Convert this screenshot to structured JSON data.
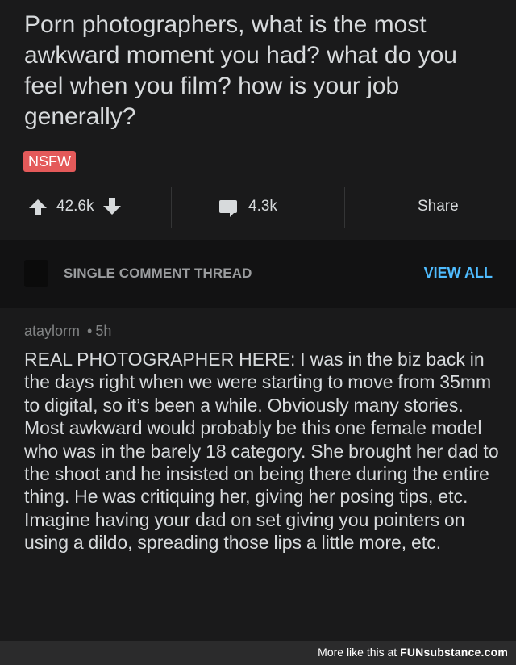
{
  "post": {
    "title": "Porn photographers, what is the most awkward moment you had? what do you feel when you film? how is your job generally?",
    "badge": "NSFW",
    "badge_color": "#e45a5a",
    "votes": "42.6k",
    "comments": "4.3k",
    "share_label": "Share"
  },
  "thread_bar": {
    "label": "SINGLE COMMENT THREAD",
    "view_all_label": "VIEW ALL",
    "view_all_color": "#4fbcff"
  },
  "comment": {
    "author": "ataylorm",
    "separator": "•",
    "age": "5h",
    "body": "REAL PHOTOGRAPHER HERE: I was in the biz back in the days right when we were starting to move from 35mm to digital, so it’s been a while. Obviously many stories. Most awkward would probably be this one female model who was in the barely 18 category. She brought her dad to the shoot and he insisted on being there during the entire thing. He was critiquing her, giving her posing tips, etc. Imagine having your dad on set giving you pointers on using a dildo, spreading those lips a little more, etc."
  },
  "footer": {
    "prefix": "More like this at",
    "brand": "FUNsubstance.com"
  },
  "icons": {
    "upvote": "upvote-arrow-icon",
    "downvote": "downvote-arrow-icon",
    "comment": "comment-bubble-icon",
    "avatar": "user-avatar"
  }
}
